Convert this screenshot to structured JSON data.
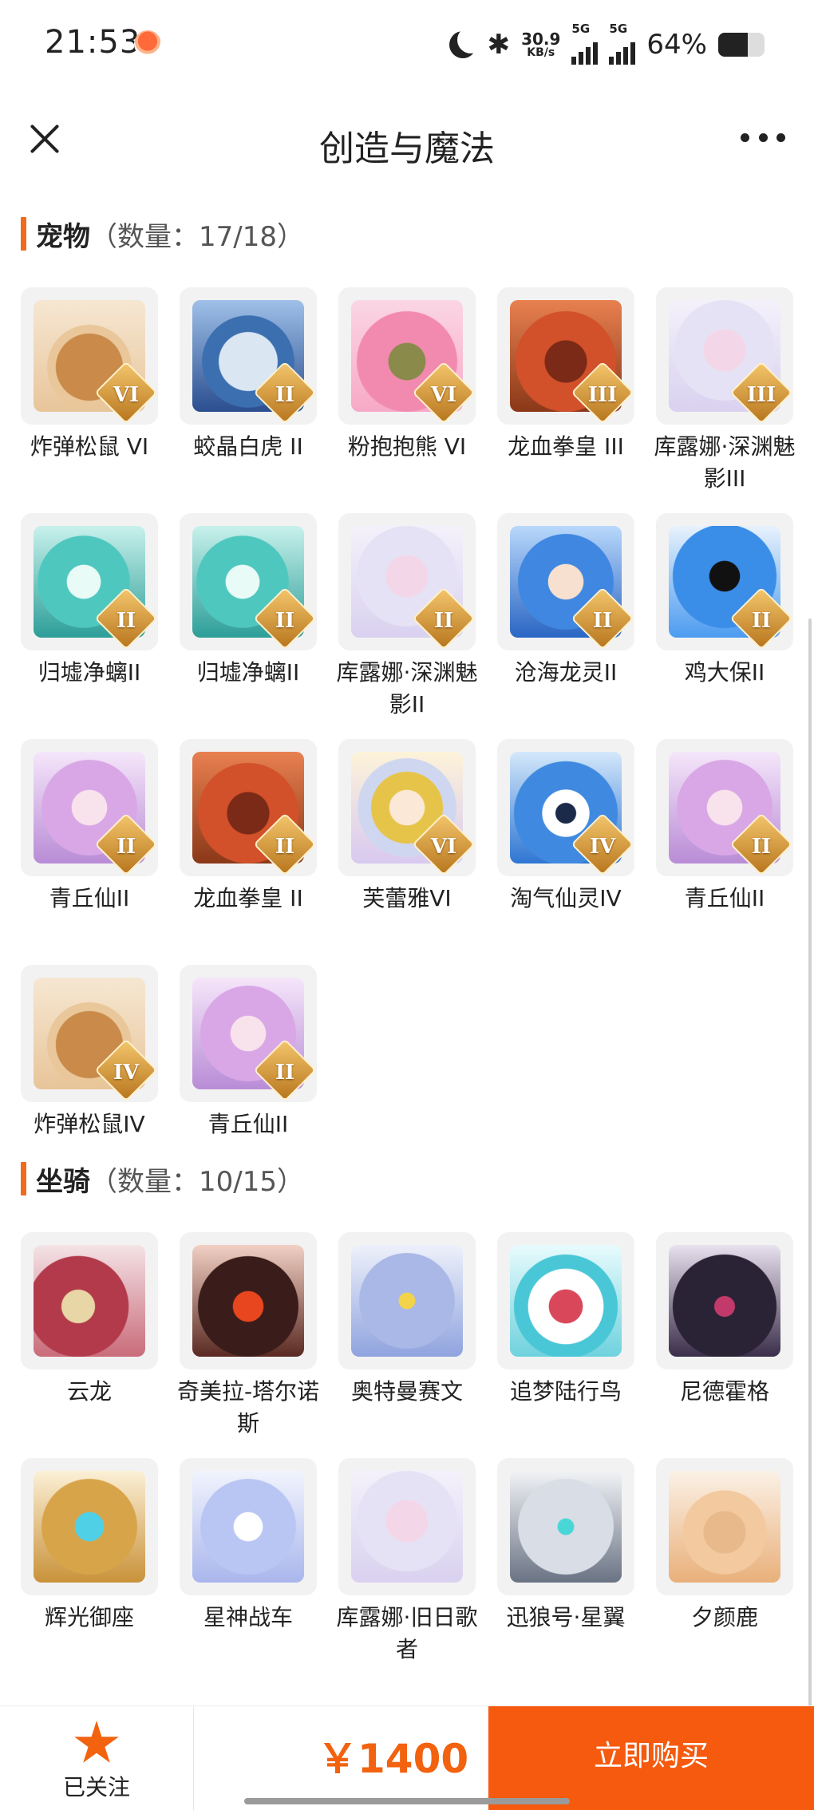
{
  "status": {
    "time": "21:53",
    "speed_value": "30.9",
    "speed_unit": "KB/s",
    "sim1": "5G",
    "sim2": "5G",
    "battery_text": "64%",
    "battery_level": 0.64
  },
  "nav": {
    "title": "创造与魔法"
  },
  "pets": {
    "title": "宠物",
    "count": "（数量：17/18）",
    "items": [
      {
        "label": "炸弹松鼠 VI",
        "tier": "VI"
      },
      {
        "label": "蛟晶白虎 II",
        "tier": "II"
      },
      {
        "label": "粉抱抱熊 VI",
        "tier": "VI"
      },
      {
        "label": "龙血拳皇 III",
        "tier": "III"
      },
      {
        "label": "库露娜·深渊魅影III",
        "tier": "III"
      },
      {
        "label": "归墟净螭II",
        "tier": "II"
      },
      {
        "label": "归墟净螭II",
        "tier": "II"
      },
      {
        "label": "库露娜·深渊魅影II",
        "tier": "II"
      },
      {
        "label": "沧海龙灵II",
        "tier": "II"
      },
      {
        "label": "鸡大保II",
        "tier": "II"
      },
      {
        "label": "青丘仙II",
        "tier": "II"
      },
      {
        "label": "龙血拳皇 II",
        "tier": "II"
      },
      {
        "label": "芙蕾雅VI",
        "tier": "VI"
      },
      {
        "label": "淘气仙灵IV",
        "tier": "IV"
      },
      {
        "label": "青丘仙II",
        "tier": "II"
      },
      {
        "label": "炸弹松鼠IV",
        "tier": "IV"
      },
      {
        "label": "青丘仙II",
        "tier": "II"
      }
    ]
  },
  "mounts": {
    "title": "坐骑",
    "count": "（数量：10/15）",
    "items": [
      {
        "label": "云龙"
      },
      {
        "label": "奇美拉-塔尔诺斯"
      },
      {
        "label": "奥特曼赛文"
      },
      {
        "label": "追梦陆行鸟"
      },
      {
        "label": "尼德霍格"
      },
      {
        "label": "辉光御座"
      },
      {
        "label": "星神战车"
      },
      {
        "label": "库露娜·旧日歌者"
      },
      {
        "label": "迅狼号·星翼"
      },
      {
        "label": "夕颜鹿"
      }
    ]
  },
  "bottom": {
    "follow_label": "已关注",
    "price": "￥1400",
    "buy_label": "立即购买"
  },
  "colors": {
    "accent": "#f55a0e",
    "tile_bg": "#f2f2f3"
  },
  "icons": [
    "close-icon",
    "more-icon",
    "star-icon",
    "moon-icon",
    "bluetooth-icon",
    "signal-icon",
    "battery-icon"
  ]
}
